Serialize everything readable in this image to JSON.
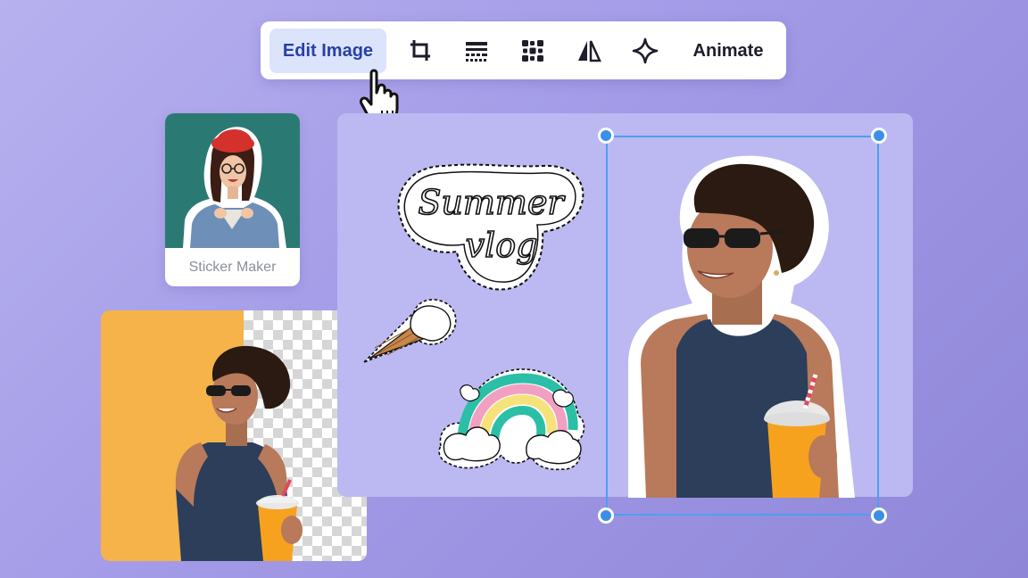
{
  "toolbar": {
    "edit_image_label": "Edit Image",
    "animate_label": "Animate",
    "icons": [
      "crop-icon",
      "filters-icon",
      "blur-icon",
      "flip-icon",
      "sparkle-icon"
    ]
  },
  "sticker_card": {
    "label": "Sticker Maker"
  },
  "canvas": {
    "sticker_text_line1": "Summer",
    "sticker_text_line2": "vlog"
  },
  "colors": {
    "accent": "#4e9ff0",
    "edit_button_bg": "#dbe4fb",
    "edit_button_text": "#2a3fa6",
    "sticker_card_bg": "#2a7a73",
    "orange_bg": "#f5b34a",
    "canvas_bg": "#bcb8f1"
  }
}
